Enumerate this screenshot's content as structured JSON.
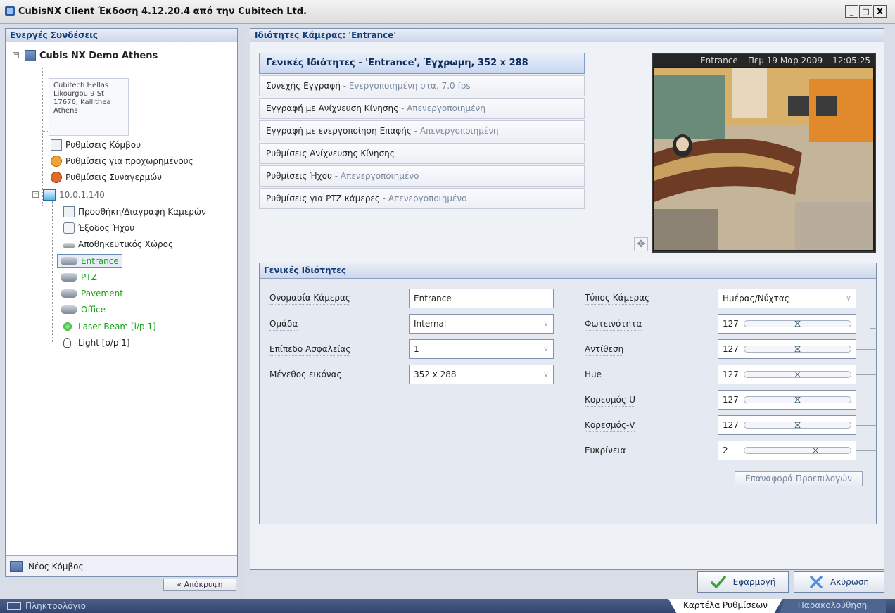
{
  "window": {
    "title": "CubisNX Client Έκδοση 4.12.20.4 από την Cubitech Ltd.",
    "buttons": [
      "_",
      "□",
      "X"
    ]
  },
  "left_panel": {
    "header": "Ενεργές Συνδέσεις",
    "root": "Cubis NX Demo Athens",
    "address": [
      "Cubitech Hellas",
      "Likourgou 9 St",
      "17676, Kallithea",
      "Athens"
    ],
    "node_settings": [
      "Ρυθμίσεις Κόμβου",
      "Ρυθμίσεις για προχωρημένους",
      "Ρυθμίσεις Συναγερμών"
    ],
    "server": "10.0.1.140",
    "server_items": [
      "Προσθήκη/Διαγραφή Καμερών",
      "Έξοδος Ήχου",
      "Αποθηκευτικός Χώρος"
    ],
    "cameras": [
      "Entrance",
      "PTZ",
      "Pavement",
      "Office"
    ],
    "io": [
      "Laser Beam  [i/p 1]",
      "Light  [o/p 1]"
    ],
    "new_node": "Νέος Κόμβος",
    "hide_button": "« Απόκρυψη"
  },
  "main_panel": {
    "header": "Ιδιότητες Κάμερας: 'Entrance'",
    "tabs": [
      {
        "label": "Γενικές Ιδιότητες",
        "status": " - 'Entrance', Έγχρωμη, 352 x 288"
      },
      {
        "label": "Συνεχής Εγγραφή",
        "status": " - Ενεργοποιημένη στα, 7.0 fps"
      },
      {
        "label": "Εγγραφή με Ανίχνευση Κίνησης",
        "status": " - Απενεργοποιημένη"
      },
      {
        "label": "Εγγραφή με ενεργοποίηση Επαφής",
        "status": " - Απενεργοποιημένη"
      },
      {
        "label": "Ρυθμίσεις Ανίχνευσης Κίνησης",
        "status": ""
      },
      {
        "label": "Ρυθμίσεις Ήχου",
        "status": " - Απενεργοποιημένο"
      },
      {
        "label": "Ρυθμίσεις για PTZ κάμερες",
        "status": " - Απενεργοποιημένο"
      }
    ],
    "video_osd": {
      "camera": "Entrance",
      "date": "Πεμ 19 Μαρ 2009",
      "time": "12:05:25"
    }
  },
  "general_props": {
    "header": "Γενικές Ιδιότητες",
    "left_fields": [
      {
        "label": "Ονομασία Κάμερας",
        "value": "Entrance"
      },
      {
        "label": "Ομάδα",
        "value": "Internal"
      },
      {
        "label": "Επίπεδο Ασφαλείας",
        "value": "1"
      },
      {
        "label": "Μέγεθος εικόνας",
        "value": "352 x 288"
      }
    ],
    "camera_type": {
      "label": "Τύπος Κάμερας",
      "value": "Ημέρας/Νύχτας"
    },
    "sliders": [
      {
        "label": "Φωτεινότητα",
        "value": "127",
        "level": 0.5
      },
      {
        "label": "Αντίθεση",
        "value": "127",
        "level": 0.5
      },
      {
        "label": "Hue",
        "value": "127",
        "level": 0.5
      },
      {
        "label": "Κορεσμός-U",
        "value": "127",
        "level": 0.5
      },
      {
        "label": "Κορεσμός-V",
        "value": "127",
        "level": 0.5
      },
      {
        "label": "Ευκρίνεια",
        "value": "2",
        "level": 0.67
      }
    ],
    "reset_button": "Επαναφορά Προεπιλογών"
  },
  "actions": {
    "apply": "Εφαρμογή",
    "cancel": "Ακύρωση"
  },
  "statusbar": {
    "keyboard": "Πληκτρολόγιο",
    "tab_settings": "Καρτέλα Ρυθμίσεων",
    "tab_monitoring": "Παρακολούθηση"
  }
}
